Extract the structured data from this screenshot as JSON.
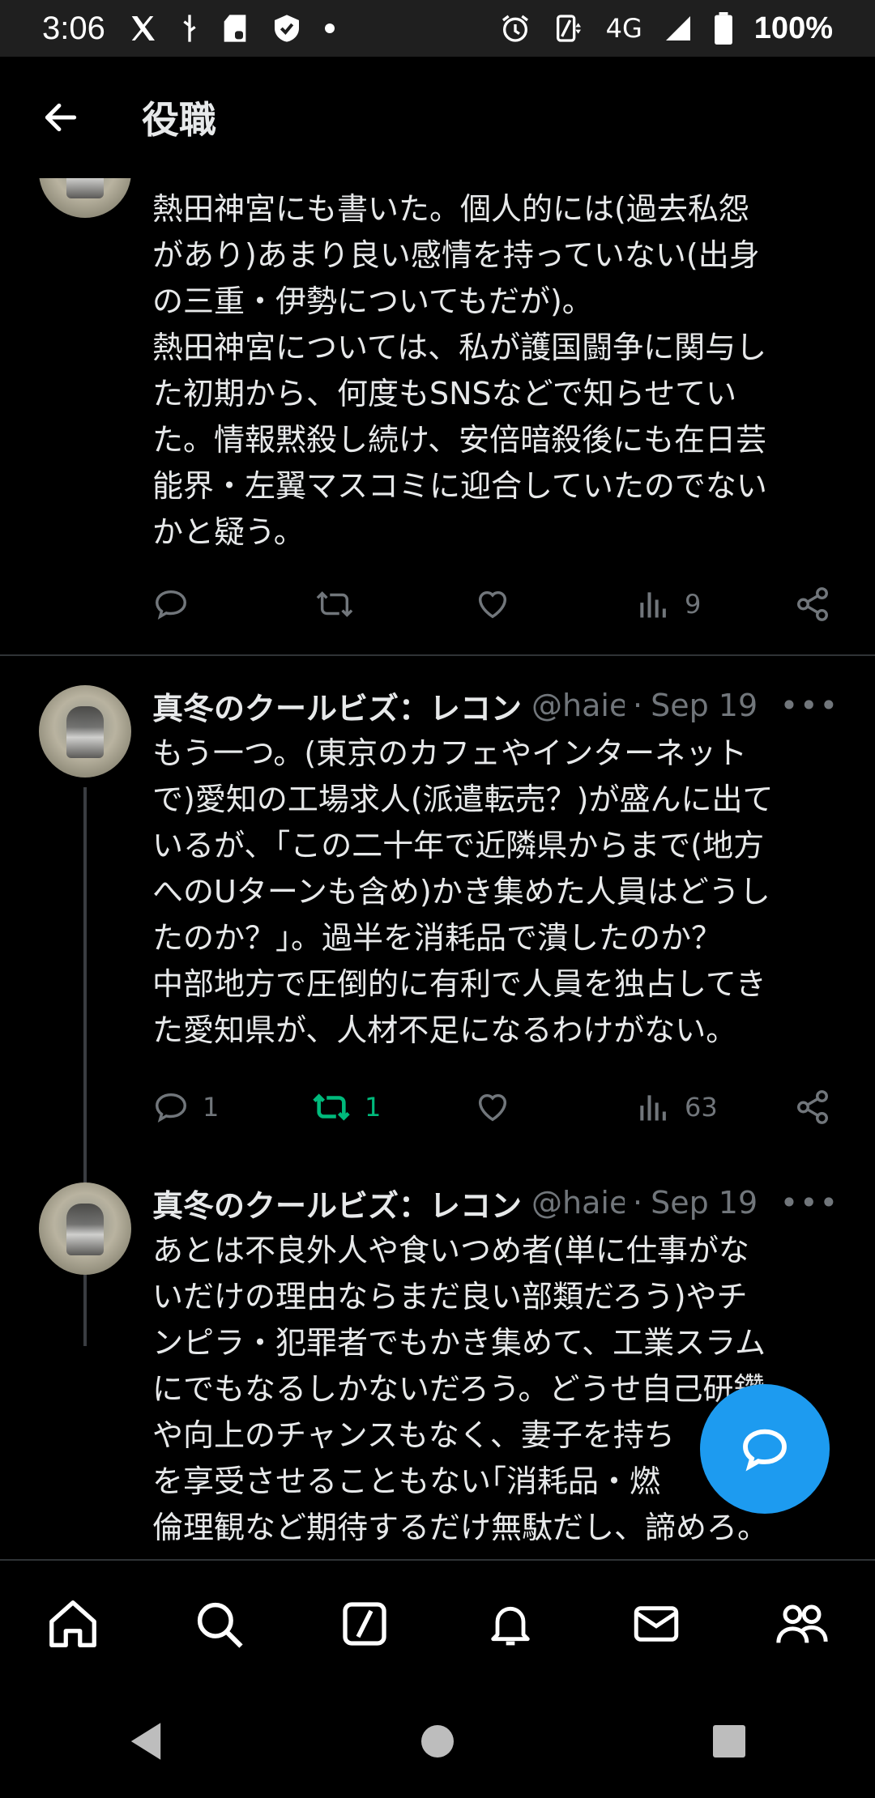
{
  "status_bar": {
    "time": "3:06",
    "network": "4G",
    "battery": "100%",
    "icons": [
      "x-icon",
      "usb-icon",
      "sd-card-icon",
      "shield-icon",
      "dot-icon",
      "alarm-icon",
      "data-saver-icon",
      "signal-icon",
      "battery-icon"
    ]
  },
  "header": {
    "title": "役職"
  },
  "tweets": [
    {
      "text": "熱田神宮にも書いた。個人的には(過去私怨\nがあり)あまり良い感情を持っていない(出身\nの三重・伊勢についてもだが)。\n熱田神宮については、私が護国闘争に関与し\nた初期から、何度もSNSなどで知らせてい\nた。情報黙殺し続け、安倍暗殺後にも在日芸\n能界・左翼マスコミに迎合していたのでない\nかと疑う。",
      "reply_count": "",
      "retweet_count": "",
      "like_count": "",
      "views": "9"
    },
    {
      "name": "真冬のクールビズ：レコン",
      "handle": "@haie",
      "separator": "·",
      "date": "Sep 19",
      "text": "もう一つ。(東京のカフェやインターネット\nで)愛知の工場求人(派遣転売？)が盛んに出て\nいるが、「この二十年で近隣県からまで(地方\nへのUターンも含め)かき集めた人員はどうし\nたのか？」。過半を消耗品で潰したのか？\n中部地方で圧倒的に有利で人員を独占してき\nた愛知県が、人材不足になるわけがない。",
      "reply_count": "1",
      "retweet_count": "1",
      "like_count": "",
      "views": "63"
    },
    {
      "name": "真冬のクールビズ：レコン",
      "handle": "@haie",
      "separator": "·",
      "date": "Sep 19",
      "text": "あとは不良外人や食いつめ者(単に仕事がな\nいだけの理由ならまだ良い部類だろう)やチ\nンピラ・犯罪者でもかき集めて、工業スラム\nにでもなるしかないだろう。どうせ自己研鑽\nや向上のチャンスもなく、妻子を持ち\nを享受させることもない｢消耗品・燃\n倫理観など期待するだけ無駄だし、諦めろ。"
    }
  ],
  "colors": {
    "accent": "#1d9bf0",
    "retweet_active": "#00ba7c",
    "secondary_text": "#71767b",
    "background": "#000000"
  },
  "bottom_nav": [
    "home-icon",
    "search-icon",
    "grok-icon",
    "bell-icon",
    "mail-icon",
    "communities-icon"
  ],
  "system_nav": [
    "back-triangle-icon",
    "home-circle-icon",
    "recents-square-icon"
  ]
}
